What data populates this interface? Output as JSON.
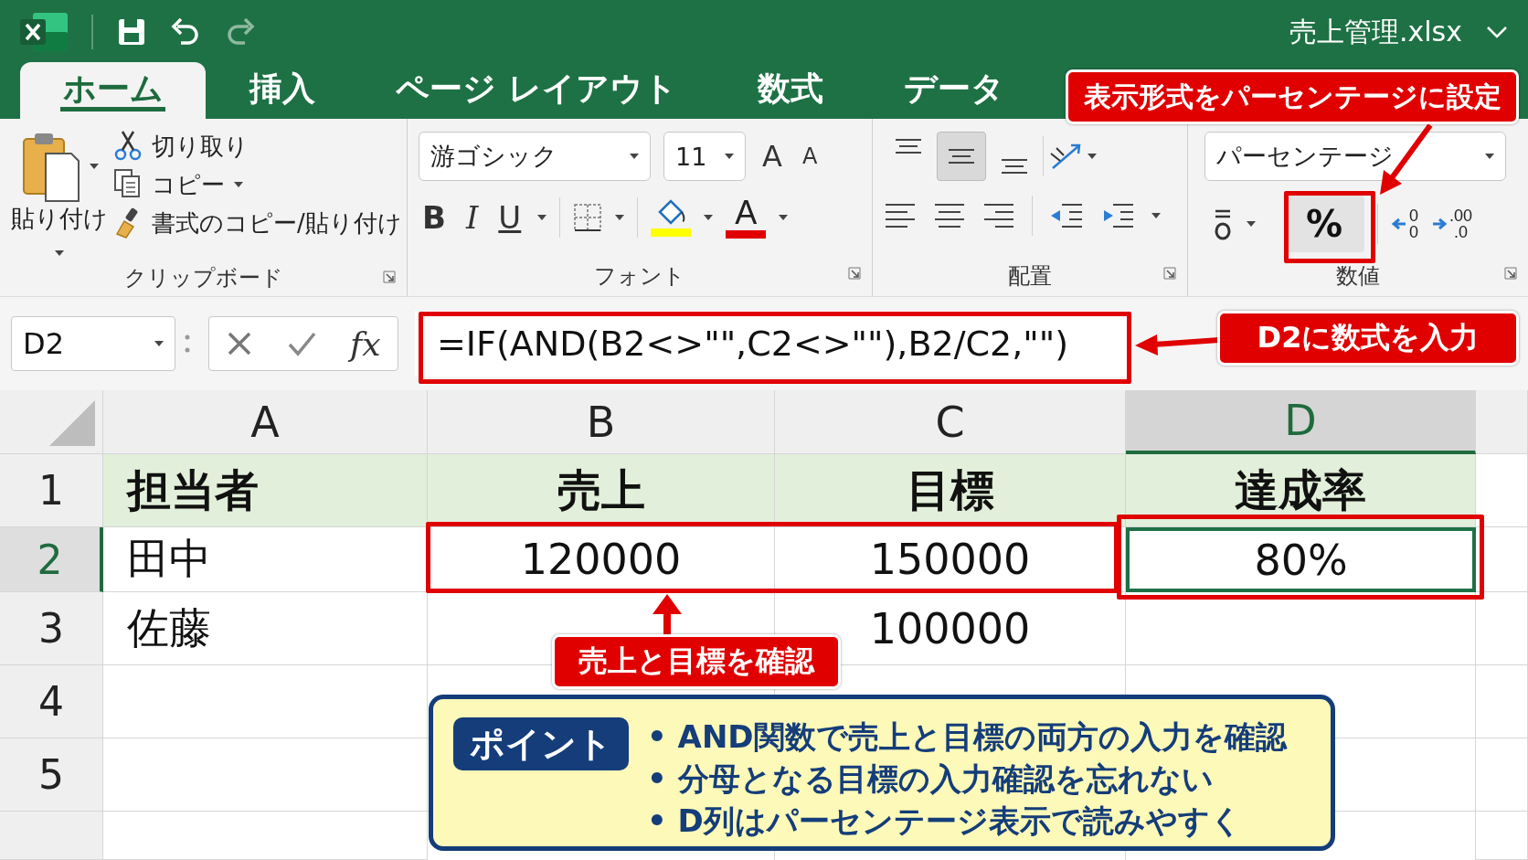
{
  "title_bar": {
    "file_name": "売上管理.xlsx"
  },
  "ribbon_tabs": [
    {
      "label": "ホーム",
      "selected": true
    },
    {
      "label": "挿入",
      "selected": false
    },
    {
      "label": "ページ レイアウト",
      "selected": false
    },
    {
      "label": "数式",
      "selected": false
    },
    {
      "label": "データ",
      "selected": false
    }
  ],
  "ribbon_groups": [
    {
      "kind": "clipboard",
      "label": "クリップボード",
      "paste_label": "貼り付け",
      "items": [
        "切り取り",
        "コピー",
        "書式のコピー/貼り付け"
      ]
    },
    {
      "kind": "font",
      "label": "フォント",
      "font_name": "游ゴシック",
      "font_size": "11",
      "grow_label": "A",
      "shrink_label": "A",
      "bold_label": "B",
      "italic_label": "I",
      "underline_label": "U",
      "font_color_label": "A"
    },
    {
      "kind": "alignment",
      "label": "配置",
      "vertical_align": [
        {
          "selected": false
        },
        {
          "selected": true
        },
        {
          "selected": false
        }
      ]
    },
    {
      "kind": "number",
      "label": "数値",
      "format": "パーセンテージ",
      "percent_label": "%",
      "decimal_buttons": [
        {
          "kind": "increase",
          "digits": [
            "0",
            "0"
          ]
        },
        {
          "kind": "decrease",
          "digits": [
            ".00",
            ".0"
          ]
        }
      ]
    }
  ],
  "formula_bar": {
    "name_box": "D2",
    "function_label": "fx",
    "formula": "=IF(AND(B2<>\"\",C2<>\"\"),B2/C2,\"\")"
  },
  "sheet": {
    "columns": [
      {
        "label": "A",
        "selected": false
      },
      {
        "label": "B",
        "selected": false
      },
      {
        "label": "C",
        "selected": false
      },
      {
        "label": "D",
        "selected": true
      }
    ],
    "rows": [
      {
        "number": "1",
        "kind": "header",
        "selected": false,
        "cells": [
          "担当者",
          "売上",
          "目標",
          "達成率"
        ]
      },
      {
        "number": "2",
        "kind": "data",
        "selected": true,
        "cells": [
          "田中",
          "120000",
          "150000",
          "80%"
        ]
      },
      {
        "number": "3",
        "kind": "data",
        "selected": false,
        "cells": [
          "佐藤",
          "",
          "100000",
          ""
        ]
      },
      {
        "number": "4",
        "kind": "data",
        "selected": false,
        "cells": [
          "",
          "",
          "",
          ""
        ]
      },
      {
        "number": "5",
        "kind": "data",
        "selected": false,
        "cells": [
          "",
          "",
          "",
          ""
        ]
      }
    ]
  },
  "callouts": [
    "表示形式をパーセンテージに設定",
    "D2に数式を入力",
    "売上と目標を確認"
  ],
  "point_box": {
    "badge": "ポイント",
    "bullets": [
      "• AND関数で売上と目標の両方の入力を確認",
      "• 分母となる目標の入力確認を忘れない",
      "• D列はパーセンテージ表示で読みやすく"
    ]
  }
}
